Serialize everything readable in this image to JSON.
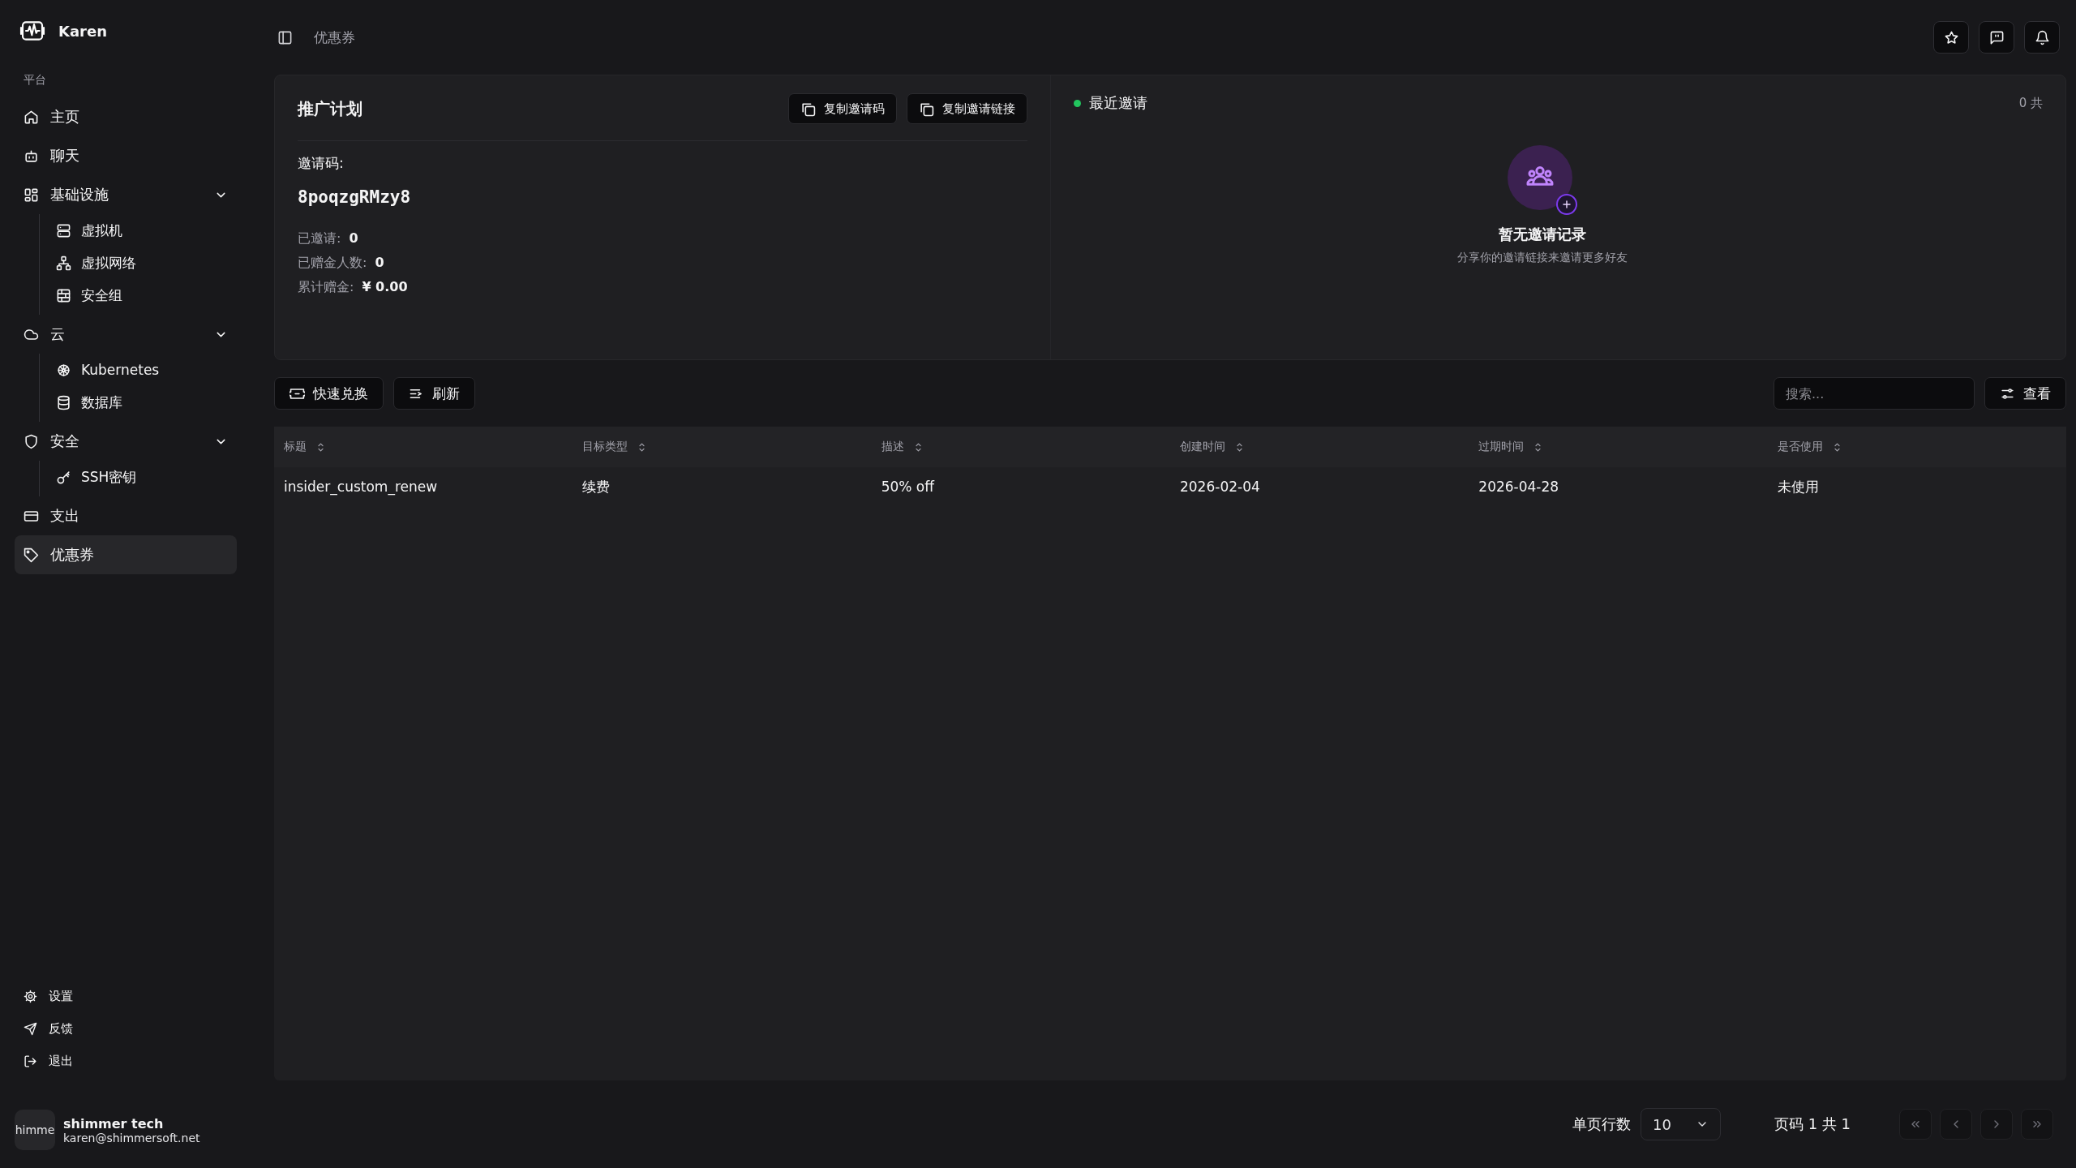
{
  "brand": {
    "name": "Karen"
  },
  "sidebar": {
    "section_label": "平台",
    "items": [
      {
        "label": "主页",
        "kind": "home",
        "selected": false
      },
      {
        "label": "聊天",
        "kind": "bot",
        "selected": false
      },
      {
        "label": "基础设施",
        "kind": "grid",
        "selected": false,
        "expanded": true,
        "children": [
          {
            "label": "虚拟机",
            "kind": "server",
            "selected": false
          },
          {
            "label": "虚拟网络",
            "kind": "network",
            "selected": false
          },
          {
            "label": "安全组",
            "kind": "brick",
            "selected": false
          }
        ]
      },
      {
        "label": "云",
        "kind": "cloud",
        "selected": false,
        "expanded": true,
        "children": [
          {
            "label": "Kubernetes",
            "kind": "wheel",
            "selected": false
          },
          {
            "label": "数据库",
            "kind": "database",
            "selected": false
          }
        ]
      },
      {
        "label": "安全",
        "kind": "shield",
        "selected": false,
        "expanded": true,
        "children": [
          {
            "label": "SSH密钥",
            "kind": "key",
            "selected": false
          }
        ]
      },
      {
        "label": "支出",
        "kind": "card",
        "selected": false
      },
      {
        "label": "优惠券",
        "kind": "tag",
        "selected": true
      }
    ],
    "footer_items": [
      {
        "label": "设置",
        "kind": "gear"
      },
      {
        "label": "反馈",
        "kind": "send"
      },
      {
        "label": "退出",
        "kind": "logout"
      }
    ],
    "user": {
      "avatar_text": "himme",
      "name": "shimmer tech",
      "email": "karen@shimmersoft.net"
    }
  },
  "header": {
    "breadcrumb": "优惠券"
  },
  "referral": {
    "title": "推广计划",
    "buttons": [
      "复制邀请码",
      "复制邀请链接"
    ],
    "code_label": "邀请码:",
    "code": "8poqzgRMzy8",
    "stats": [
      {
        "label": "已邀请:",
        "value": "0"
      },
      {
        "label": "已赠金人数:",
        "value": "0"
      },
      {
        "label": "累计赠金:",
        "value": "¥ 0.00"
      }
    ],
    "recent": {
      "title": "最近邀请",
      "count": "0 共",
      "empty_title": "暂无邀请记录",
      "empty_hint": "分享你的邀请链接来邀请更多好友"
    }
  },
  "toolbar": {
    "buttons": [
      {
        "label": "快速兑换",
        "kind": "ticket"
      },
      {
        "label": "刷新",
        "kind": "list"
      }
    ],
    "search": {
      "placeholder": "搜索..."
    },
    "view_button": "查看"
  },
  "table": {
    "columns": [
      "标题",
      "目标类型",
      "描述",
      "创建时间",
      "过期时间",
      "是否使用"
    ],
    "rows": [
      [
        "insider_custom_renew",
        "续费",
        "50% off",
        "2026-02-04",
        "2026-04-28",
        "未使用"
      ]
    ]
  },
  "pagination": {
    "rows_label": "单页行数",
    "rows_per_page": "10",
    "page_text": "页码 1 共 1"
  }
}
